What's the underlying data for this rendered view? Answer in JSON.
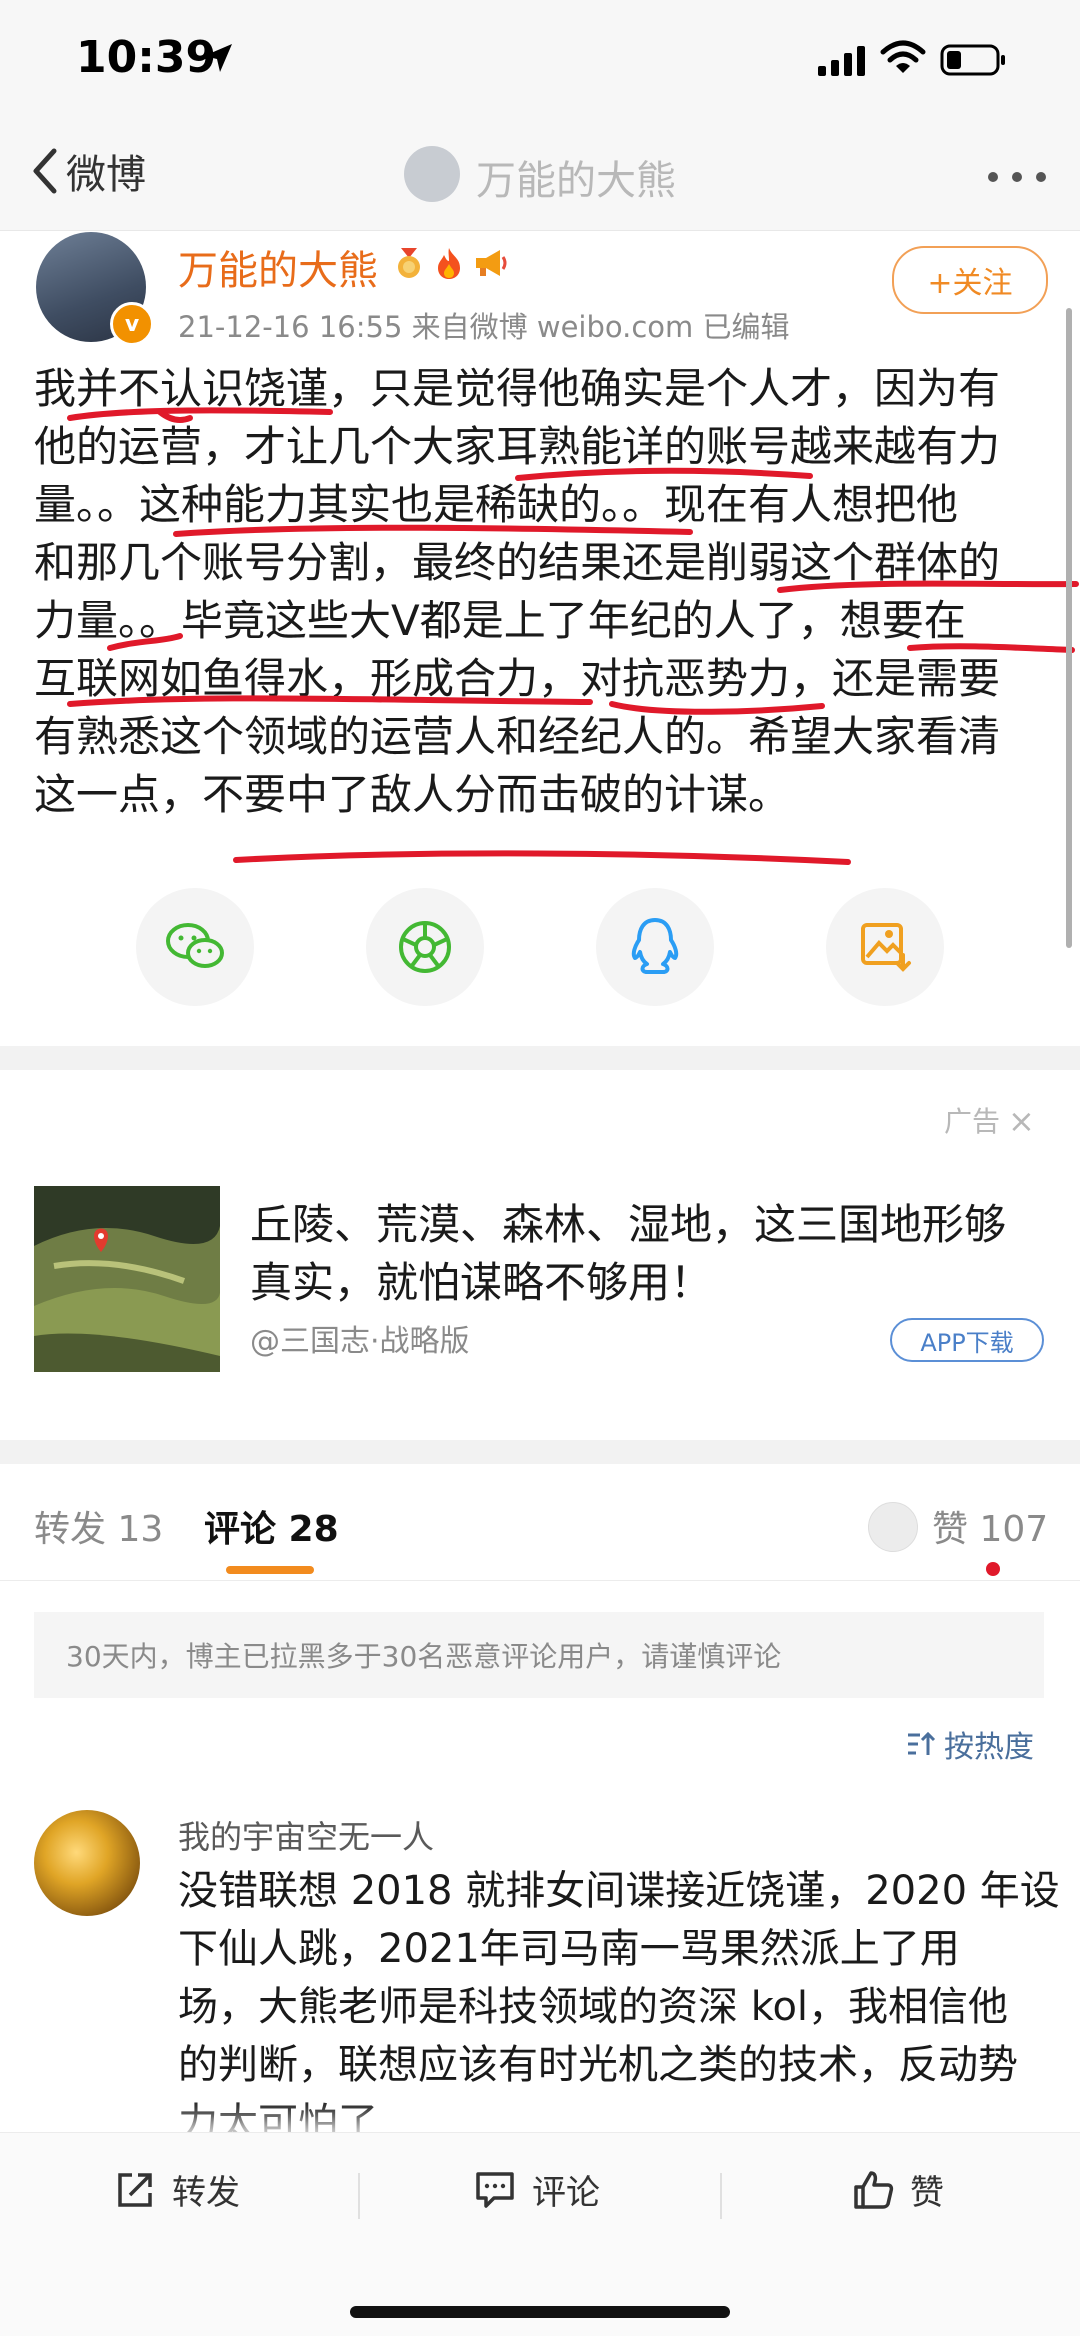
{
  "status_bar": {
    "time": "10:39"
  },
  "nav": {
    "back_label": "微博",
    "title": "万能的大熊"
  },
  "post": {
    "author": "万能的大熊",
    "vip_mark": "v",
    "meta": "21-12-16 16:55  来自微博 weibo.com  已编辑",
    "follow_label": "+关注",
    "lines": [
      "我并不认识饶谨，只是觉得他确实是个人才，因为有",
      "他的运营，才让几个大家耳熟能详的账号越来越有力",
      "量。。这种能力其实也是稀缺的。。现在有人想把他",
      "和那几个账号分割，最终的结果还是削弱这个群体的",
      "力量。。毕竟这些大V都是上了年纪的人了，想要在",
      "互联网如鱼得水，形成合力，对抗恶势力，还是需要",
      "有熟悉这个领域的运营人和经纪人的。希望大家看清",
      "这一点，不要中了敌人分而击破的计谋。"
    ]
  },
  "share": [
    "wechat-icon",
    "moments-icon",
    "qq-icon",
    "save-image-icon"
  ],
  "ad": {
    "label": "广告",
    "close": "×",
    "lines": [
      "丘陵、荒漠、森林、湿地，这三国地形够",
      "真实，就怕谋略不够用！"
    ],
    "source": "@三国志·战略版",
    "download_label": "APP下载"
  },
  "tabs": {
    "forward": "转发 13",
    "comments": "评论 28",
    "likes": "赞 107"
  },
  "notice": "30天内，博主已拉黑多于30名恶意评论用户，请谨慎评论",
  "sort_label": "按热度",
  "comment": {
    "user": "我的宇宙空无一人",
    "lines": [
      "没错联想 2018 就排女间谍接近饶谨，2020 年设",
      "下仙人跳，2021年司马南一骂果然派上了用",
      "场，大熊老师是科技领域的资深 kol，我相信他",
      "的判断，联想应该有时光机之类的技术，反动势",
      "力太可怕了"
    ]
  },
  "actions": {
    "forward": "转发",
    "comment": "评论",
    "like": "赞"
  },
  "colors": {
    "accent": "#f08a24",
    "annotation": "#e0192a",
    "link": "#4a6f9c"
  }
}
